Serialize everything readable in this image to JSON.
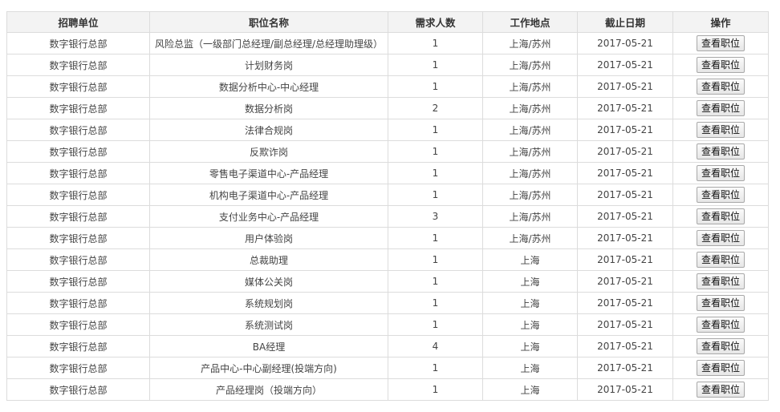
{
  "table": {
    "headers": {
      "unit": "招聘单位",
      "title": "职位名称",
      "count": "需求人数",
      "location": "工作地点",
      "deadline": "截止日期",
      "action": "操作"
    },
    "rows": [
      {
        "unit": "数字银行总部",
        "title": "风险总监（一级部门总经理/副总经理/总经理助理级）",
        "count": "1",
        "location": "上海/苏州",
        "deadline": "2017-05-21",
        "action": "查看职位"
      },
      {
        "unit": "数字银行总部",
        "title": "计划财务岗",
        "count": "1",
        "location": "上海/苏州",
        "deadline": "2017-05-21",
        "action": "查看职位"
      },
      {
        "unit": "数字银行总部",
        "title": "数据分析中心-中心经理",
        "count": "1",
        "location": "上海/苏州",
        "deadline": "2017-05-21",
        "action": "查看职位"
      },
      {
        "unit": "数字银行总部",
        "title": "数据分析岗",
        "count": "2",
        "location": "上海/苏州",
        "deadline": "2017-05-21",
        "action": "查看职位"
      },
      {
        "unit": "数字银行总部",
        "title": "法律合规岗",
        "count": "1",
        "location": "上海/苏州",
        "deadline": "2017-05-21",
        "action": "查看职位"
      },
      {
        "unit": "数字银行总部",
        "title": "反欺诈岗",
        "count": "1",
        "location": "上海/苏州",
        "deadline": "2017-05-21",
        "action": "查看职位"
      },
      {
        "unit": "数字银行总部",
        "title": "零售电子渠道中心-产品经理",
        "count": "1",
        "location": "上海/苏州",
        "deadline": "2017-05-21",
        "action": "查看职位"
      },
      {
        "unit": "数字银行总部",
        "title": "机构电子渠道中心-产品经理",
        "count": "1",
        "location": "上海/苏州",
        "deadline": "2017-05-21",
        "action": "查看职位"
      },
      {
        "unit": "数字银行总部",
        "title": "支付业务中心-产品经理",
        "count": "3",
        "location": "上海/苏州",
        "deadline": "2017-05-21",
        "action": "查看职位"
      },
      {
        "unit": "数字银行总部",
        "title": "用户体验岗",
        "count": "1",
        "location": "上海/苏州",
        "deadline": "2017-05-21",
        "action": "查看职位"
      },
      {
        "unit": "数字银行总部",
        "title": "总裁助理",
        "count": "1",
        "location": "上海",
        "deadline": "2017-05-21",
        "action": "查看职位"
      },
      {
        "unit": "数字银行总部",
        "title": "媒体公关岗",
        "count": "1",
        "location": "上海",
        "deadline": "2017-05-21",
        "action": "查看职位"
      },
      {
        "unit": "数字银行总部",
        "title": "系统规划岗",
        "count": "1",
        "location": "上海",
        "deadline": "2017-05-21",
        "action": "查看职位"
      },
      {
        "unit": "数字银行总部",
        "title": "系统测试岗",
        "count": "1",
        "location": "上海",
        "deadline": "2017-05-21",
        "action": "查看职位"
      },
      {
        "unit": "数字银行总部",
        "title": "BA经理",
        "count": "4",
        "location": "上海",
        "deadline": "2017-05-21",
        "action": "查看职位"
      },
      {
        "unit": "数字银行总部",
        "title": "产品中心-中心副经理(投端方向)",
        "count": "1",
        "location": "上海",
        "deadline": "2017-05-21",
        "action": "查看职位"
      },
      {
        "unit": "数字银行总部",
        "title": "产品经理岗（投端方向）",
        "count": "1",
        "location": "上海",
        "deadline": "2017-05-21",
        "action": "查看职位"
      }
    ]
  }
}
